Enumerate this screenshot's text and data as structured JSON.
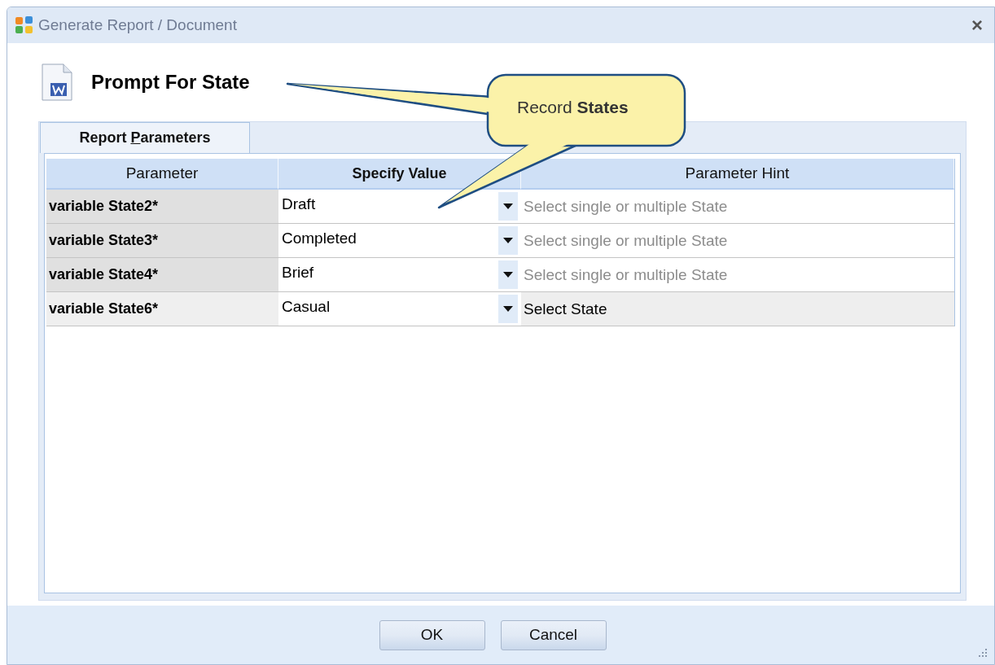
{
  "window": {
    "title": "Generate Report / Document"
  },
  "heading": "Prompt For State",
  "callout": {
    "text": "Record **States**"
  },
  "tabs": [
    {
      "label_start": "Report ",
      "mnemonic": "P",
      "label_end": "arameters",
      "selected": true
    }
  ],
  "table": {
    "columns": [
      {
        "label": "Parameter",
        "bold": false
      },
      {
        "label": "Specify Value",
        "bold": true
      },
      {
        "label": "Parameter Hint",
        "bold": false
      }
    ],
    "rows": [
      {
        "parameter": "variable State2*",
        "value": "Draft",
        "hint_placeholder": "Select single or multiple State",
        "selected": false
      },
      {
        "parameter": "variable State3*",
        "value": "Completed",
        "hint_placeholder": "Select single or multiple State",
        "selected": false
      },
      {
        "parameter": "variable State4*",
        "value": "Brief",
        "hint_placeholder": "Select single or multiple State",
        "selected": false
      },
      {
        "parameter": "variable State6*",
        "value": "Casual",
        "hint_value": "Select State",
        "selected": true
      }
    ]
  },
  "buttons": [
    "OK",
    "Cancel"
  ],
  "close": "×"
}
